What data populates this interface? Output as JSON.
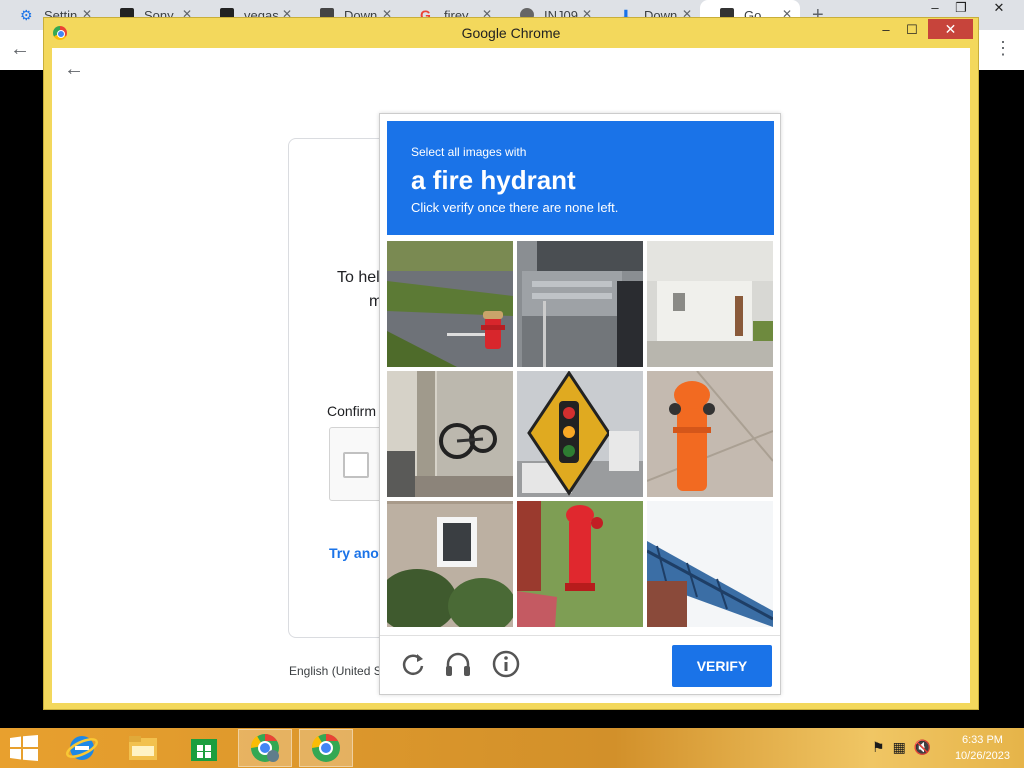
{
  "background_browser": {
    "tabs": [
      {
        "title": "Settin",
        "color": "#1a73e8"
      },
      {
        "title": "Sony",
        "color": "#222222"
      },
      {
        "title": "vegas",
        "color": "#222222"
      },
      {
        "title": "Down",
        "color": "#444444"
      },
      {
        "title": "firey",
        "color": "#ea4335"
      },
      {
        "title": "INJ09",
        "color": "#666666"
      },
      {
        "title": "Down",
        "color": "#1a73e8"
      },
      {
        "title": "Go",
        "color": "#333333"
      }
    ],
    "new_tab": "+"
  },
  "popup": {
    "title": "Google Chrome",
    "buttons": {
      "minimize": "–",
      "maximize": "☐",
      "close": "✕"
    }
  },
  "page": {
    "text_line1": "To hel",
    "text_line2": "m",
    "confirm_label": "Confirm",
    "try_link": "Try anot",
    "language": "English (United S"
  },
  "captcha": {
    "header_line1": "Select all images with",
    "header_line2": "a fire hydrant",
    "header_line3": "Click verify once there are none left.",
    "tiles": [
      {
        "label": "tile-1-street-hydrant"
      },
      {
        "label": "tile-2-steps-car"
      },
      {
        "label": "tile-3-building"
      },
      {
        "label": "tile-4-bicycle"
      },
      {
        "label": "tile-5-traffic-sign"
      },
      {
        "label": "tile-6-orange-hydrant"
      },
      {
        "label": "tile-7-house-bushes"
      },
      {
        "label": "tile-8-red-hydrant"
      },
      {
        "label": "tile-9-bridge"
      }
    ],
    "verify_label": "VERIFY"
  },
  "taskbar": {
    "clock_time": "6:33 PM",
    "clock_date": "10/26/2023"
  },
  "colors": {
    "accent": "#1a73e8",
    "popup_frame": "#f3d85c",
    "taskbar": "#e8a02e"
  }
}
